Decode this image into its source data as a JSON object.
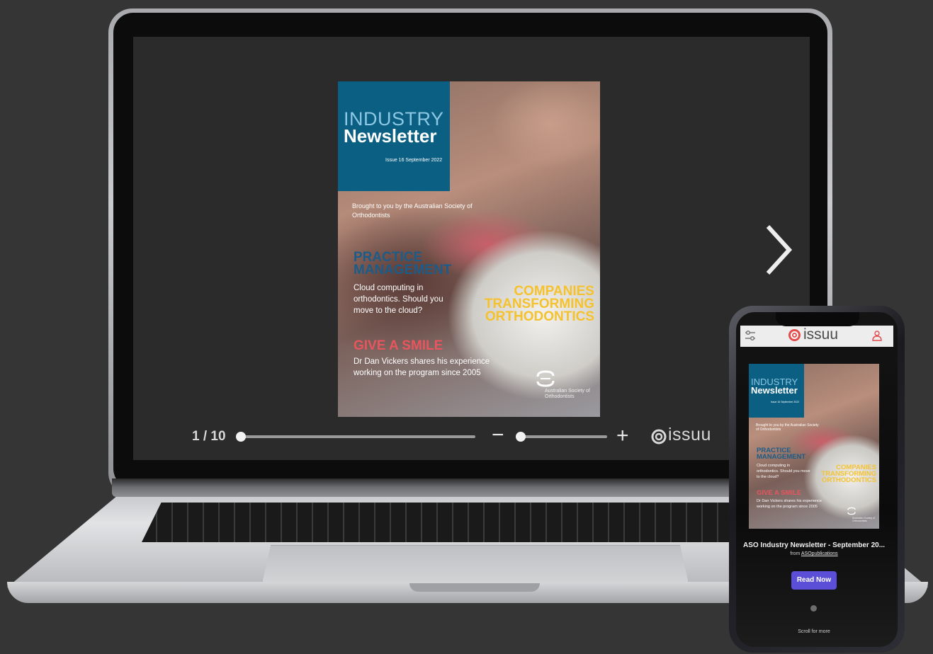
{
  "reader": {
    "page_counter": "1 / 10",
    "page_progress": 0.0,
    "zoom_level": 0.0,
    "zoom_out_icon": "minus-icon",
    "zoom_in_icon": "plus-icon",
    "next_icon": "chevron-right-icon",
    "brand": "issuu"
  },
  "cover": {
    "title_line1": "INDUSTRY",
    "title_line2": "Newsletter",
    "issue": "Issue 16 September 2022",
    "brought_by": "Brought to you by the Australian Society of Orthodontists",
    "headline1": "PRACTICE MANAGEMENT",
    "body1": "Cloud computing in orthodontics. Should you move to the cloud?",
    "headline2": "COMPANIES TRANSFORMING ORTHODONTICS",
    "headline3": "GIVE A SMILE",
    "body3": "Dr Dan Vickers shares his experience working on the program since 2005",
    "publisher_mark": "Australian Society of Orthodontists"
  },
  "phone": {
    "brand": "issuu",
    "menu_icon": "settings-sliders-icon",
    "profile_icon": "user-icon",
    "doc_title": "ASO Industry Newsletter - September 20...",
    "from_label": "from",
    "publisher": "ASOpublications",
    "read_now": "Read Now",
    "scroll_hint": "Scroll for more"
  },
  "colors": {
    "cover_blue": "#0a5f82",
    "headline_blue": "#1b5c88",
    "headline_yellow": "#f5c22e",
    "headline_red": "#e9555f",
    "read_now_button": "#5a4fd6",
    "issuu_red": "#e44b4b"
  }
}
